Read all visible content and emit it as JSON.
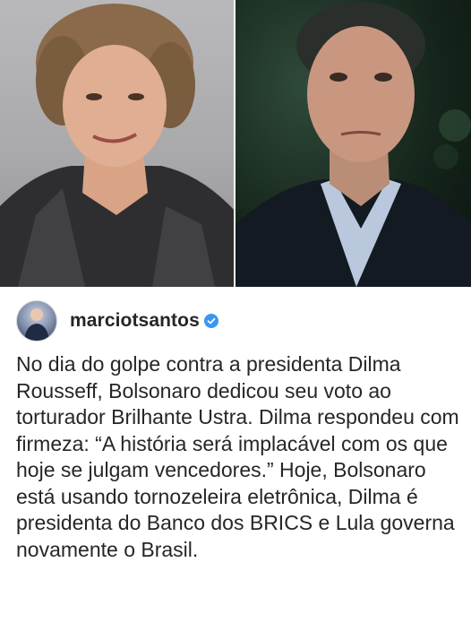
{
  "post": {
    "username": "marciotsantos",
    "verified_icon": "verified-badge-icon",
    "caption": "No dia do golpe contra a presidenta Dilma Rousseff, Bolsonaro dedicou seu voto ao torturador Brilhante Ustra. Dilma respondeu com firmeza: “A história será implacável com os que hoje se julgam vencedores.” Hoje, Bolsonaro está usando tornozeleira eletrônica, Dilma é presidenta do Banco dos BRICS e Lula governa novamente o Brasil."
  },
  "colors": {
    "verified": "#3897f0",
    "text": "#262626"
  }
}
